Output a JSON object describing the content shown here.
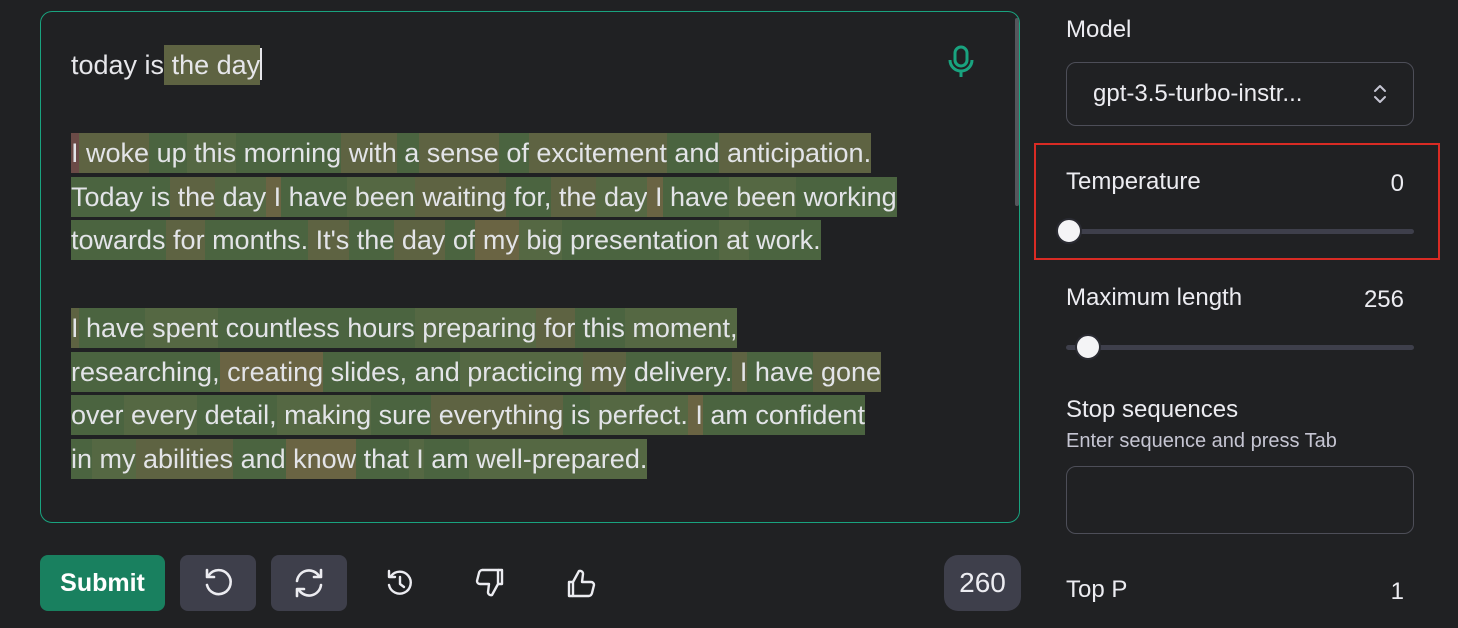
{
  "editor": {
    "prompt": "today is the day",
    "mic_icon": "microphone-icon",
    "paragraphs": [
      [
        [
          [
            "I",
            "r1"
          ],
          [
            " woke",
            "o1"
          ],
          [
            " up",
            "g2"
          ],
          [
            " this",
            "g3"
          ],
          [
            " morning",
            "g2"
          ],
          [
            " with",
            "o1"
          ],
          [
            " a",
            "g2"
          ],
          [
            " sense",
            "o1"
          ],
          [
            " of",
            "g2"
          ],
          [
            " excitement",
            "o1"
          ],
          [
            " and",
            "g2"
          ],
          [
            " anticipation.",
            "o1"
          ]
        ],
        [
          [
            "Today",
            "g2"
          ],
          [
            " is",
            "g2"
          ],
          [
            " the",
            "o1"
          ],
          [
            " day",
            "g3"
          ],
          [
            " I",
            "o2"
          ],
          [
            " have",
            "g2"
          ],
          [
            " been",
            "g3"
          ],
          [
            " waiting",
            "o1"
          ],
          [
            " for,",
            "g2"
          ],
          [
            " the",
            "o1"
          ],
          [
            " day",
            "g3"
          ],
          [
            " I",
            "o2"
          ],
          [
            " have",
            "g2"
          ],
          [
            " been",
            "g3"
          ],
          [
            " working",
            "g2"
          ]
        ],
        [
          [
            "towards",
            "g2"
          ],
          [
            " for",
            "o1"
          ],
          [
            " months.",
            "g2"
          ],
          [
            " It's",
            "o1"
          ],
          [
            " the",
            "g2"
          ],
          [
            " day",
            "o1"
          ],
          [
            " of",
            "g2"
          ],
          [
            " my",
            "o2"
          ],
          [
            " big",
            "g3"
          ],
          [
            " presentation",
            "g2"
          ],
          [
            " at",
            "g3"
          ],
          [
            " work.",
            "g2"
          ]
        ]
      ],
      [
        [
          [
            "I",
            "o1"
          ],
          [
            " have",
            "g2"
          ],
          [
            " spent",
            "g3"
          ],
          [
            " countless",
            "g2"
          ],
          [
            " hours",
            "g2"
          ],
          [
            " preparing",
            "g3"
          ],
          [
            " for",
            "o1"
          ],
          [
            " this",
            "g2"
          ],
          [
            " moment,",
            "g3"
          ]
        ],
        [
          [
            "researching,",
            "g2"
          ],
          [
            " creating",
            "o2"
          ],
          [
            " slides,",
            "g2"
          ],
          [
            " and",
            "g2"
          ],
          [
            " practicing",
            "g3"
          ],
          [
            " my",
            "o1"
          ],
          [
            " delivery.",
            "g2"
          ],
          [
            " I",
            "o1"
          ],
          [
            " have",
            "g2"
          ],
          [
            " gone",
            "o1"
          ]
        ],
        [
          [
            "over",
            "g2"
          ],
          [
            " every",
            "g3"
          ],
          [
            " detail,",
            "g2"
          ],
          [
            " making",
            "g3"
          ],
          [
            " sure",
            "g2"
          ],
          [
            " everything",
            "o1"
          ],
          [
            " is",
            "g2"
          ],
          [
            " perfect.",
            "g3"
          ],
          [
            " I",
            "o2"
          ],
          [
            " am",
            "g2"
          ],
          [
            " confident",
            "g2"
          ]
        ],
        [
          [
            "in",
            "g2"
          ],
          [
            " my",
            "g3"
          ],
          [
            " abilities",
            "o1"
          ],
          [
            " and",
            "g2"
          ],
          [
            " know",
            "o2"
          ],
          [
            " that",
            "g2"
          ],
          [
            " I",
            "g3"
          ],
          [
            " am",
            "g2"
          ],
          [
            " well-prepared.",
            "g3"
          ]
        ]
      ]
    ]
  },
  "toolbar": {
    "submit_label": "Submit",
    "undo_icon": "undo-icon",
    "regenerate_icon": "regenerate-icon",
    "history_icon": "history-icon",
    "thumbs_down_icon": "thumbs-down-icon",
    "thumbs_up_icon": "thumbs-up-icon",
    "token_count": "260"
  },
  "panel": {
    "model_label": "Model",
    "model_value": "gpt-3.5-turbo-instr...",
    "temperature_label": "Temperature",
    "temperature_value": "0",
    "temperature_level": 0,
    "max_length_label": "Maximum length",
    "max_length_value": "256",
    "max_length_level": 0.06,
    "stop_label": "Stop sequences",
    "stop_help": "Enter sequence and press Tab",
    "top_p_label": "Top P",
    "top_p_value": "1"
  },
  "colors": {
    "accent": "#19a37f",
    "submit": "#19805f",
    "highlight_box": "#d92b24"
  }
}
